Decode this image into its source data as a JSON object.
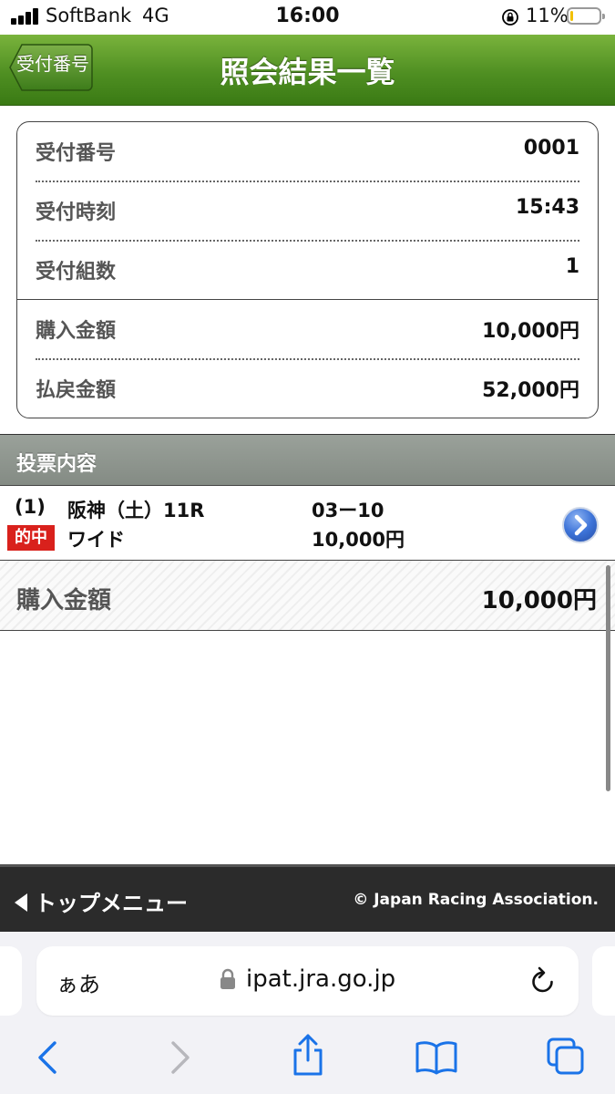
{
  "status_bar": {
    "carrier": "SoftBank",
    "network": "4G",
    "time": "16:00",
    "battery_percent": "11%",
    "battery_level": 0.11
  },
  "header": {
    "back_label": "受付番号",
    "title": "照会結果一覧"
  },
  "info_card": {
    "rows": [
      {
        "label": "受付番号",
        "value": "0001"
      },
      {
        "label": "受付時刻",
        "value": "15:43"
      },
      {
        "label": "受付組数",
        "value": "1"
      },
      {
        "label": "購入金額",
        "value": "10,000円"
      },
      {
        "label": "払戻金額",
        "value": "52,000円"
      }
    ]
  },
  "section": {
    "title": "投票内容"
  },
  "bets": [
    {
      "index": "(1)",
      "race": "阪神（土）11R",
      "combination": "03ー10",
      "result_badge": "的中",
      "bet_type": "ワイド",
      "amount": "10,000円"
    }
  ],
  "total": {
    "label": "購入金額",
    "value": "10,000円"
  },
  "footer": {
    "top_menu_label": "トップメニュー",
    "copyright": "© Japan Racing Association."
  },
  "browser": {
    "text_size_label": "ぁあ",
    "url": "ipat.jra.go.jp"
  },
  "colors": {
    "header_green": "#4f8f22",
    "hit_red": "#d9211c",
    "ios_blue": "#1a73e8"
  }
}
